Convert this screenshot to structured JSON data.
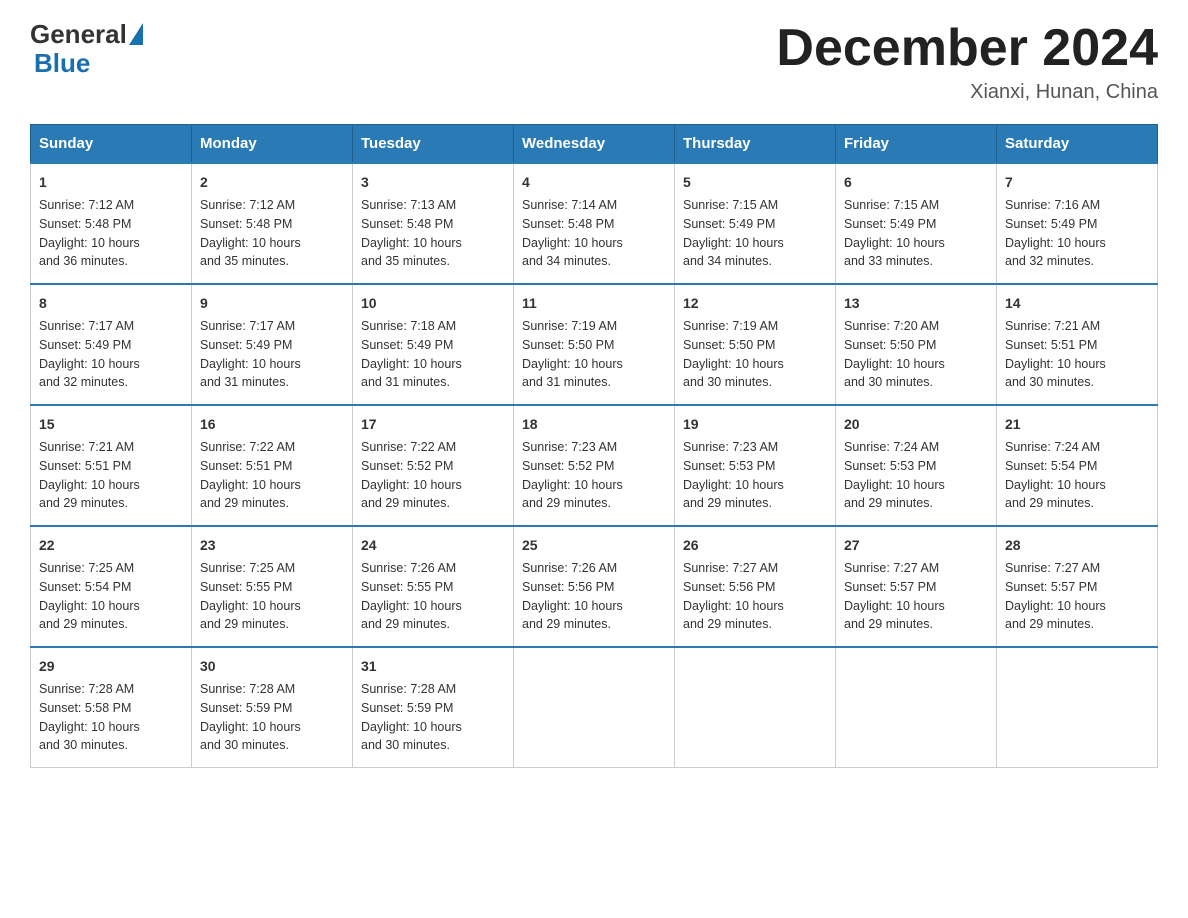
{
  "logo": {
    "text_general": "General",
    "text_blue": "Blue"
  },
  "title": "December 2024",
  "location": "Xianxi, Hunan, China",
  "days_of_week": [
    "Sunday",
    "Monday",
    "Tuesday",
    "Wednesday",
    "Thursday",
    "Friday",
    "Saturday"
  ],
  "weeks": [
    [
      {
        "day": "1",
        "sunrise": "7:12 AM",
        "sunset": "5:48 PM",
        "daylight": "10 hours and 36 minutes."
      },
      {
        "day": "2",
        "sunrise": "7:12 AM",
        "sunset": "5:48 PM",
        "daylight": "10 hours and 35 minutes."
      },
      {
        "day": "3",
        "sunrise": "7:13 AM",
        "sunset": "5:48 PM",
        "daylight": "10 hours and 35 minutes."
      },
      {
        "day": "4",
        "sunrise": "7:14 AM",
        "sunset": "5:48 PM",
        "daylight": "10 hours and 34 minutes."
      },
      {
        "day": "5",
        "sunrise": "7:15 AM",
        "sunset": "5:49 PM",
        "daylight": "10 hours and 34 minutes."
      },
      {
        "day": "6",
        "sunrise": "7:15 AM",
        "sunset": "5:49 PM",
        "daylight": "10 hours and 33 minutes."
      },
      {
        "day": "7",
        "sunrise": "7:16 AM",
        "sunset": "5:49 PM",
        "daylight": "10 hours and 32 minutes."
      }
    ],
    [
      {
        "day": "8",
        "sunrise": "7:17 AM",
        "sunset": "5:49 PM",
        "daylight": "10 hours and 32 minutes."
      },
      {
        "day": "9",
        "sunrise": "7:17 AM",
        "sunset": "5:49 PM",
        "daylight": "10 hours and 31 minutes."
      },
      {
        "day": "10",
        "sunrise": "7:18 AM",
        "sunset": "5:49 PM",
        "daylight": "10 hours and 31 minutes."
      },
      {
        "day": "11",
        "sunrise": "7:19 AM",
        "sunset": "5:50 PM",
        "daylight": "10 hours and 31 minutes."
      },
      {
        "day": "12",
        "sunrise": "7:19 AM",
        "sunset": "5:50 PM",
        "daylight": "10 hours and 30 minutes."
      },
      {
        "day": "13",
        "sunrise": "7:20 AM",
        "sunset": "5:50 PM",
        "daylight": "10 hours and 30 minutes."
      },
      {
        "day": "14",
        "sunrise": "7:21 AM",
        "sunset": "5:51 PM",
        "daylight": "10 hours and 30 minutes."
      }
    ],
    [
      {
        "day": "15",
        "sunrise": "7:21 AM",
        "sunset": "5:51 PM",
        "daylight": "10 hours and 29 minutes."
      },
      {
        "day": "16",
        "sunrise": "7:22 AM",
        "sunset": "5:51 PM",
        "daylight": "10 hours and 29 minutes."
      },
      {
        "day": "17",
        "sunrise": "7:22 AM",
        "sunset": "5:52 PM",
        "daylight": "10 hours and 29 minutes."
      },
      {
        "day": "18",
        "sunrise": "7:23 AM",
        "sunset": "5:52 PM",
        "daylight": "10 hours and 29 minutes."
      },
      {
        "day": "19",
        "sunrise": "7:23 AM",
        "sunset": "5:53 PM",
        "daylight": "10 hours and 29 minutes."
      },
      {
        "day": "20",
        "sunrise": "7:24 AM",
        "sunset": "5:53 PM",
        "daylight": "10 hours and 29 minutes."
      },
      {
        "day": "21",
        "sunrise": "7:24 AM",
        "sunset": "5:54 PM",
        "daylight": "10 hours and 29 minutes."
      }
    ],
    [
      {
        "day": "22",
        "sunrise": "7:25 AM",
        "sunset": "5:54 PM",
        "daylight": "10 hours and 29 minutes."
      },
      {
        "day": "23",
        "sunrise": "7:25 AM",
        "sunset": "5:55 PM",
        "daylight": "10 hours and 29 minutes."
      },
      {
        "day": "24",
        "sunrise": "7:26 AM",
        "sunset": "5:55 PM",
        "daylight": "10 hours and 29 minutes."
      },
      {
        "day": "25",
        "sunrise": "7:26 AM",
        "sunset": "5:56 PM",
        "daylight": "10 hours and 29 minutes."
      },
      {
        "day": "26",
        "sunrise": "7:27 AM",
        "sunset": "5:56 PM",
        "daylight": "10 hours and 29 minutes."
      },
      {
        "day": "27",
        "sunrise": "7:27 AM",
        "sunset": "5:57 PM",
        "daylight": "10 hours and 29 minutes."
      },
      {
        "day": "28",
        "sunrise": "7:27 AM",
        "sunset": "5:57 PM",
        "daylight": "10 hours and 29 minutes."
      }
    ],
    [
      {
        "day": "29",
        "sunrise": "7:28 AM",
        "sunset": "5:58 PM",
        "daylight": "10 hours and 30 minutes."
      },
      {
        "day": "30",
        "sunrise": "7:28 AM",
        "sunset": "5:59 PM",
        "daylight": "10 hours and 30 minutes."
      },
      {
        "day": "31",
        "sunrise": "7:28 AM",
        "sunset": "5:59 PM",
        "daylight": "10 hours and 30 minutes."
      },
      null,
      null,
      null,
      null
    ]
  ],
  "labels": {
    "sunrise": "Sunrise:",
    "sunset": "Sunset:",
    "daylight": "Daylight:"
  }
}
